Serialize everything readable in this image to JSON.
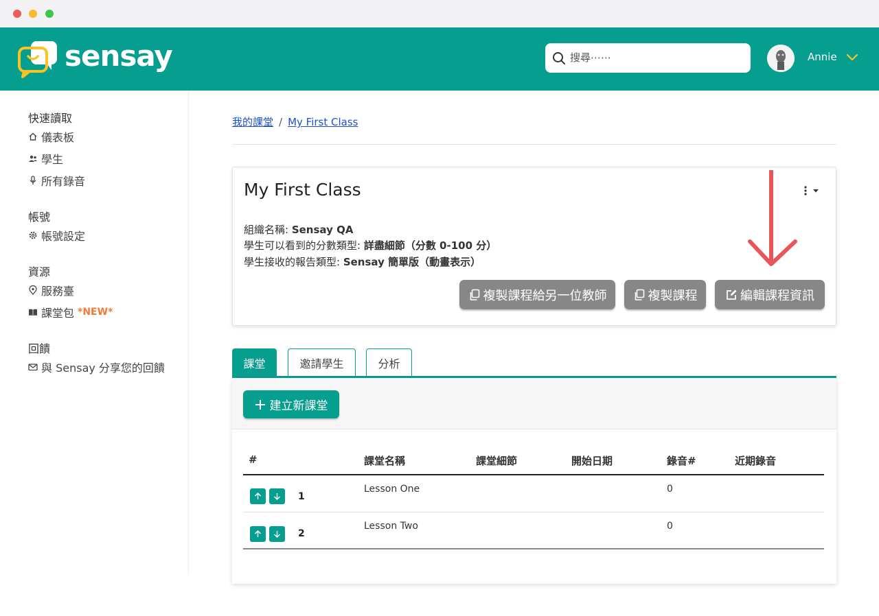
{
  "app": {
    "brand": "sensay",
    "search_placeholder": "搜尋⋯⋯",
    "user_name": "Annie"
  },
  "sidebar": {
    "groups": [
      {
        "title": "快速讀取",
        "items": [
          {
            "label": "儀表板",
            "icon": "home-icon"
          },
          {
            "label": "學生",
            "icon": "users-icon"
          },
          {
            "label": "所有錄音",
            "icon": "microphone-icon"
          }
        ]
      },
      {
        "title": "帳號",
        "items": [
          {
            "label": "帳號設定",
            "icon": "gear-icon"
          }
        ]
      },
      {
        "title": "資源",
        "items": [
          {
            "label": "服務臺",
            "icon": "location-pin-icon"
          },
          {
            "label": "課堂包",
            "icon": "book-icon",
            "badge": "*NEW*"
          }
        ]
      },
      {
        "title": "回饋",
        "items": [
          {
            "label": "與 Sensay 分享您的回饋",
            "icon": "mail-icon"
          }
        ]
      }
    ]
  },
  "breadcrumb": {
    "root": "我的課堂",
    "separator": "/",
    "current": "My First Class"
  },
  "class_card": {
    "title": "My First Class",
    "org_label": "組織名稱: ",
    "org_value": "Sensay QA",
    "score_label": "學生可以看到的分數類型: ",
    "score_value": "詳盡細節（分數 0-100 分）",
    "report_label": "學生接收的報告類型: ",
    "report_value": "Sensay 簡單版（動畫表示）",
    "buttons": {
      "copy_to_teacher": "複製課程給另一位教師",
      "copy_course": "複製課程",
      "edit_info": "編輯課程資訊"
    }
  },
  "tabs": [
    {
      "label": "課堂",
      "active": true
    },
    {
      "label": "邀請學生",
      "active": false
    },
    {
      "label": "分析",
      "active": false
    }
  ],
  "lessons": {
    "new_button": "建立新課堂",
    "columns": [
      "#",
      "課堂名稱",
      "課堂細節",
      "開始日期",
      "錄音#",
      "近期錄音"
    ],
    "rows": [
      {
        "num": "1",
        "name": "Lesson One",
        "details": "",
        "start": "",
        "recordings": "0",
        "recent": ""
      },
      {
        "num": "2",
        "name": "Lesson Two",
        "details": "",
        "start": "",
        "recordings": "0",
        "recent": ""
      }
    ]
  },
  "colors": {
    "brand": "#069e8f",
    "accent_yellow": "#f7c325",
    "arrow": "#e8565a",
    "button_grey": "#878787",
    "new_badge": "#f07c3a"
  }
}
